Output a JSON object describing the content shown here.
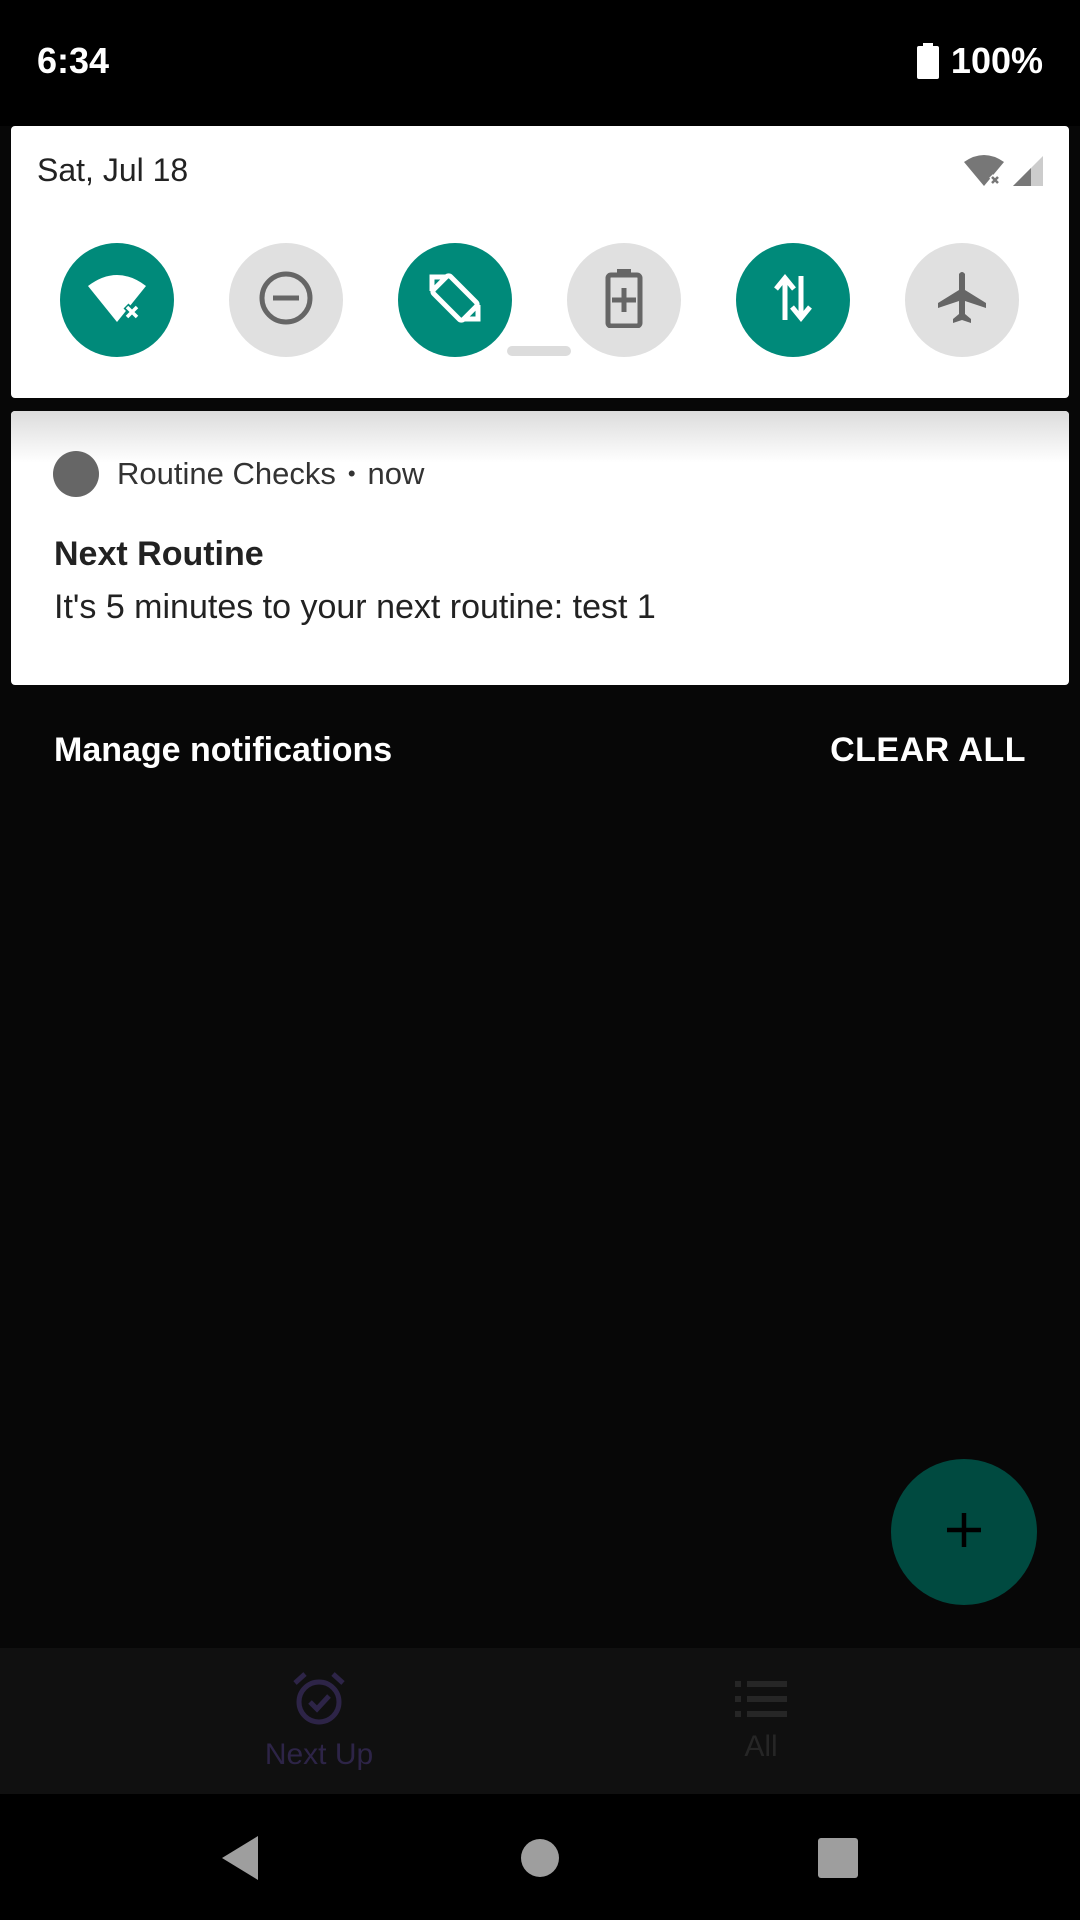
{
  "status_bar": {
    "time": "6:34",
    "battery_percent": "100%",
    "icons": [
      "battery-full-icon"
    ]
  },
  "quick_settings": {
    "date": "Sat, Jul 18",
    "status_icons": [
      "wifi-off-icon",
      "cell-signal-icon"
    ],
    "tiles": [
      {
        "name": "wifi-off-icon",
        "state": "on"
      },
      {
        "name": "do-not-disturb-icon",
        "state": "off"
      },
      {
        "name": "auto-rotate-icon",
        "state": "on"
      },
      {
        "name": "battery-saver-icon",
        "state": "off"
      },
      {
        "name": "mobile-data-icon",
        "state": "on"
      },
      {
        "name": "airplane-mode-icon",
        "state": "off"
      }
    ]
  },
  "notification": {
    "app_name": "Routine Checks",
    "separator": "•",
    "time": "now",
    "title": "Next Routine",
    "text": "It's 5 minutes to your next routine: test 1"
  },
  "shade_footer": {
    "manage_label": "Manage notifications",
    "clear_all_label": "CLEAR ALL"
  },
  "app": {
    "fab_icon": "plus-icon",
    "bottom_nav": [
      {
        "label": "Next Up",
        "icon": "alarm-check-icon",
        "active": true
      },
      {
        "label": "All",
        "icon": "list-icon",
        "active": false
      }
    ]
  },
  "colors": {
    "accent": "#008a7a",
    "tile_off": "#e0e0e0"
  },
  "system_nav": [
    "back-icon",
    "home-icon",
    "recents-icon"
  ]
}
